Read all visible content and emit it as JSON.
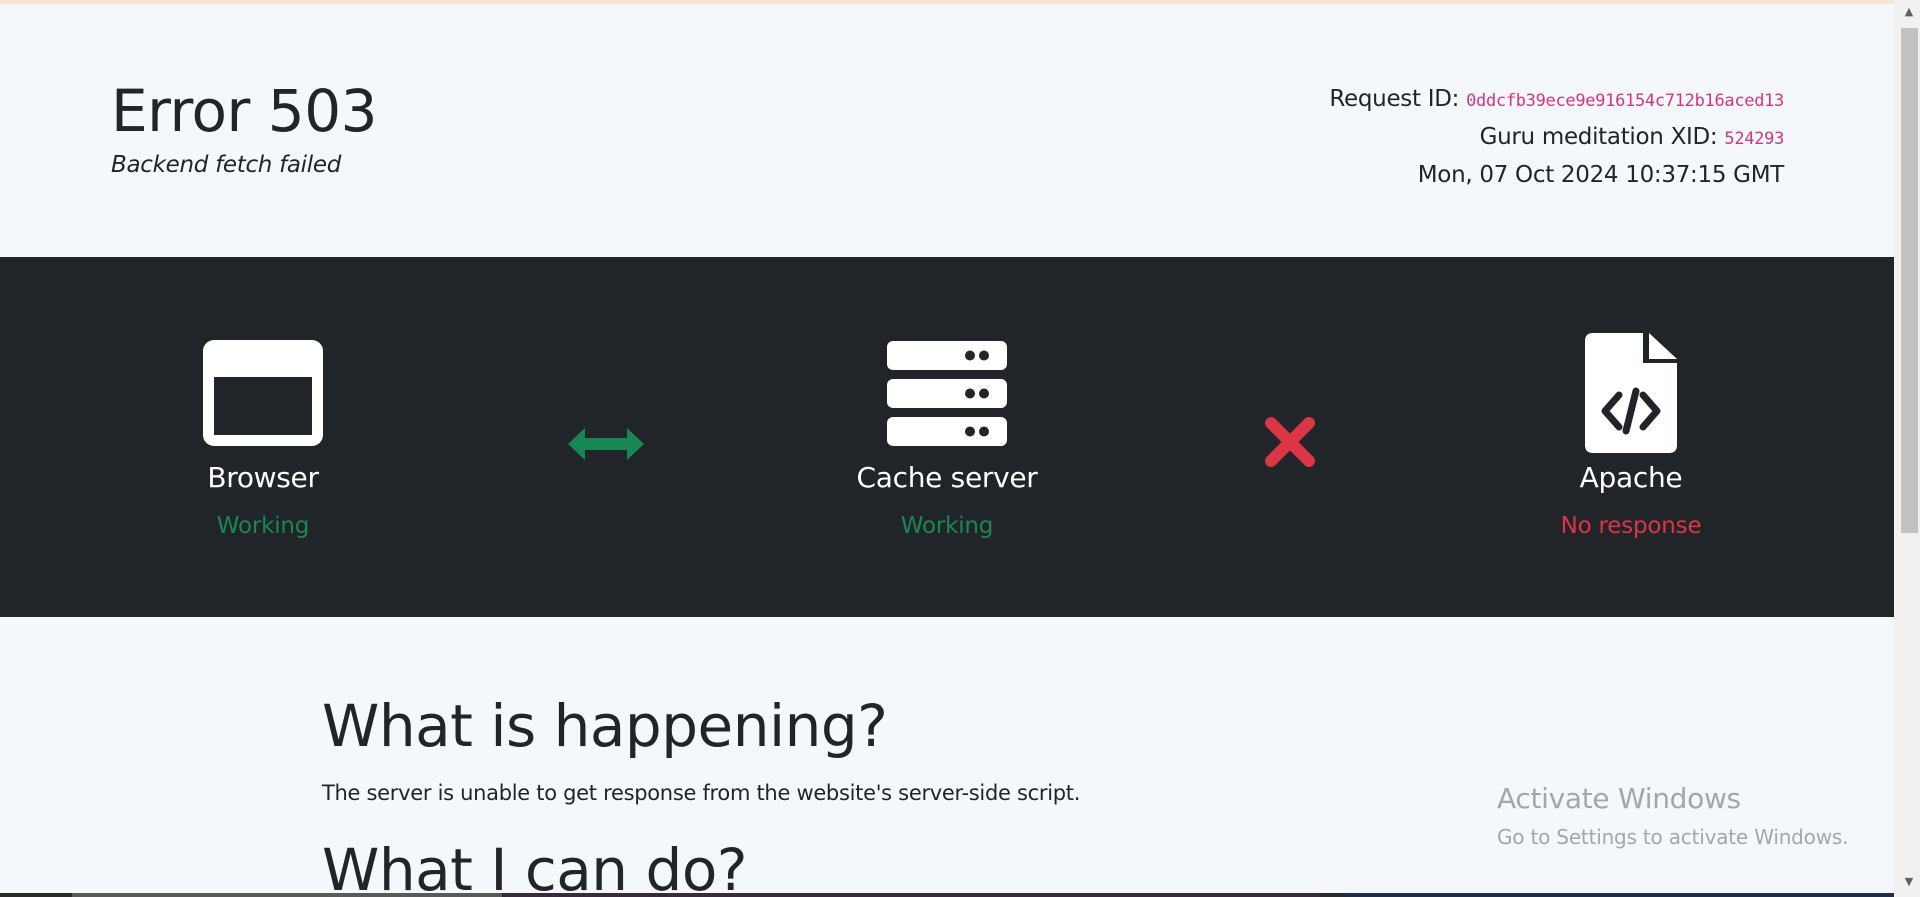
{
  "header": {
    "title": "Error 503",
    "subtitle": "Backend fetch failed",
    "request_id_label": "Request ID:",
    "request_id_value": "0ddcfb39ece9e916154c712b16aced13",
    "xid_label": "Guru meditation XID:",
    "xid_value": "524293",
    "timestamp": "Mon, 07 Oct 2024 10:37:15 GMT"
  },
  "status": {
    "nodes": [
      {
        "name": "Browser",
        "status": "Working",
        "icon": "browser-window-icon",
        "state": "ok"
      },
      {
        "name": "Cache server",
        "status": "Working",
        "icon": "server-icon",
        "state": "ok"
      },
      {
        "name": "Apache",
        "status": "No response",
        "icon": "code-file-icon",
        "state": "error"
      }
    ],
    "connectors": [
      {
        "icon": "double-arrow-icon",
        "state": "ok"
      },
      {
        "icon": "x-mark-icon",
        "state": "error"
      }
    ],
    "colors": {
      "background": "#212529",
      "ok": "#198754",
      "error": "#dc3545"
    }
  },
  "content": {
    "what_heading": "What is happening?",
    "what_text": "The server is unable to get response from the website's server-side script.",
    "can_heading": "What I can do?"
  },
  "watermark": {
    "title": "Activate Windows",
    "subtitle": "Go to Settings to activate Windows."
  }
}
